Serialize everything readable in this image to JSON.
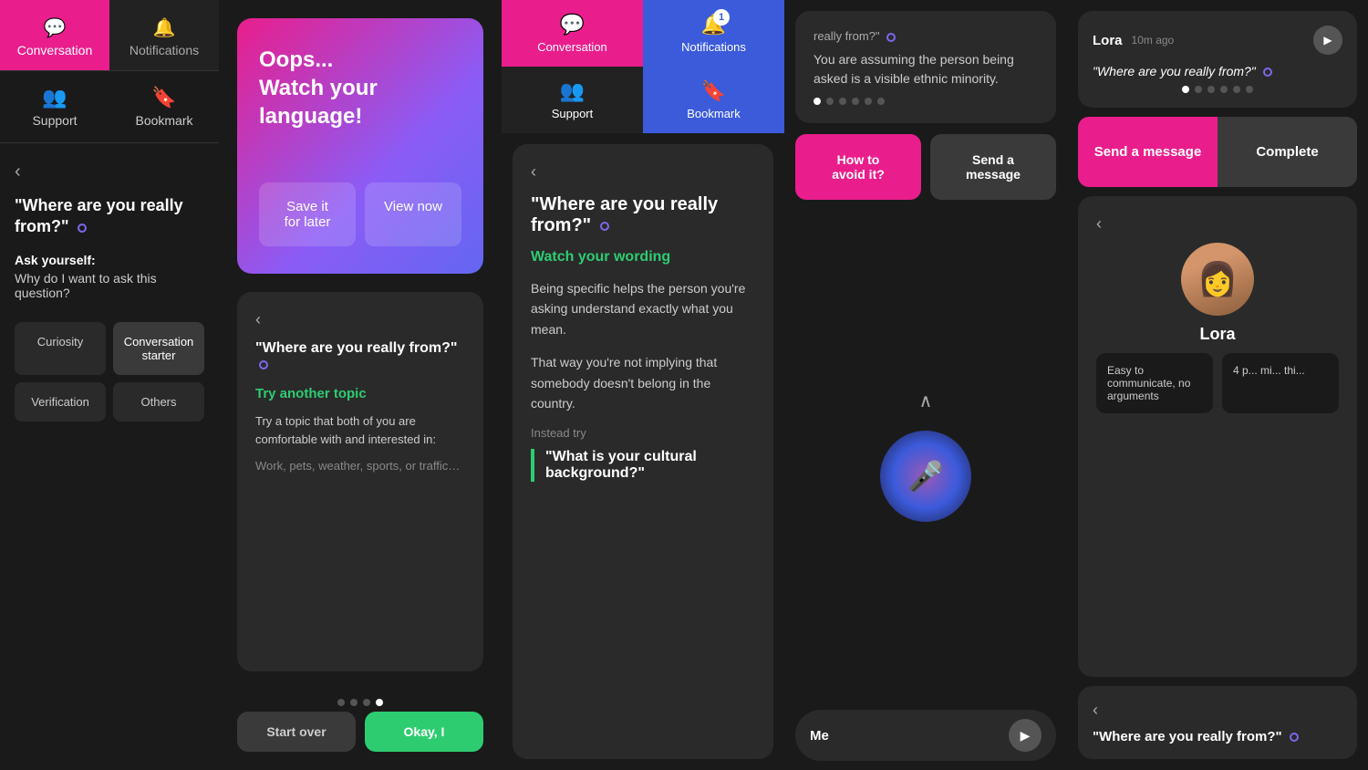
{
  "panel_left": {
    "tabs": [
      {
        "id": "conversation",
        "label": "Conversation",
        "icon": "💬",
        "active": true
      },
      {
        "id": "notifications",
        "label": "Notifications",
        "icon": "🔔",
        "active": false
      }
    ],
    "bottom_tabs": [
      {
        "id": "support",
        "label": "Support",
        "icon": "👥"
      },
      {
        "id": "bookmark",
        "label": "Bookmark",
        "icon": "🔖"
      }
    ],
    "back_arrow": "‹",
    "question": "\"Where are you really from?\"",
    "dot": "○",
    "ask_yourself_label": "Ask yourself:",
    "ask_yourself_text": "Why do I want to ask this question?",
    "categories": [
      {
        "id": "curiosity",
        "label": "Curiosity"
      },
      {
        "id": "conversation-starter",
        "label": "Conversation starter",
        "active": true
      },
      {
        "id": "verification",
        "label": "Verification"
      },
      {
        "id": "others",
        "label": "Others"
      }
    ]
  },
  "panel_oops": {
    "card": {
      "title_line1": "Oops...",
      "title_line2": "Watch your language!",
      "btn_save": "Save it\nfor later",
      "btn_view": "View now"
    },
    "try_topic": {
      "back_arrow": "‹",
      "question": "\"Where are you really from?\"",
      "dot": "○",
      "heading": "Try another topic",
      "desc": "Try a topic that both of you are comfortable with and interested in:",
      "examples": "Work, pets, weather, sports, or traffic…"
    },
    "pagination": [
      {
        "active": false
      },
      {
        "active": false
      },
      {
        "active": false
      },
      {
        "active": true
      }
    ],
    "bottom_btns": {
      "start_over": "Start over",
      "okay": "Okay, I"
    }
  },
  "panel_mid": {
    "nav": [
      {
        "id": "conversation",
        "label": "Conversation",
        "icon": "💬",
        "active_class": "conversation"
      },
      {
        "id": "notifications",
        "label": "Notifications",
        "icon": "🔔",
        "active_class": "notifications",
        "badge": "1"
      }
    ],
    "nav_bottom": [
      {
        "id": "support",
        "label": "Support",
        "icon": "👥"
      },
      {
        "id": "bookmark",
        "label": "Bookmark",
        "icon": "🔖",
        "active": true
      }
    ],
    "card": {
      "back_arrow": "‹",
      "question": "\"Where are you really from?\"",
      "dot": "○",
      "heading": "Watch your wording",
      "body1": "Being specific helps the person you're asking understand exactly what you mean.",
      "body2": "That way you're not implying that somebody doesn't belong in the country.",
      "instead_label": "Instead try",
      "alt_question": "\"What is your cultural background?\""
    }
  },
  "panel_right_mid": {
    "top_text": {
      "question_prefix": "really from?\"",
      "dot": "○",
      "body": "You are assuming the person being asked is a visible ethnic minority."
    },
    "pagination": [
      {
        "active": true
      },
      {
        "active": false
      },
      {
        "active": false
      },
      {
        "active": false
      },
      {
        "active": false
      },
      {
        "active": false
      }
    ],
    "action_btns": {
      "avoid": "How to\navoid it?",
      "send": "Send a\nmessage"
    },
    "mic": {
      "chevron": "∧",
      "icon": "🎤"
    },
    "me_row": {
      "label": "Me",
      "play_icon": "▶"
    }
  },
  "panel_far_right": {
    "top_chat": {
      "name": "Lora",
      "time": "10m ago",
      "play_icon": "▶",
      "bubble": "\"Where are you really from?\"",
      "dot": "○"
    },
    "pagination": [
      {
        "active": true
      },
      {
        "active": false
      },
      {
        "active": false
      },
      {
        "active": false
      },
      {
        "active": false
      },
      {
        "active": false
      }
    ],
    "action_btns": {
      "send": "Send a message",
      "complete": "Complete"
    },
    "profile": {
      "back_arrow": "‹",
      "name": "Lora",
      "reviews": [
        {
          "text": "Easy to communicate, no arguments"
        },
        {
          "text": "4 p... mi... thi..."
        }
      ]
    },
    "bottom_chat": {
      "back_arrow": "‹",
      "question": "\"Where are you really from?\"",
      "dot": "○"
    }
  }
}
